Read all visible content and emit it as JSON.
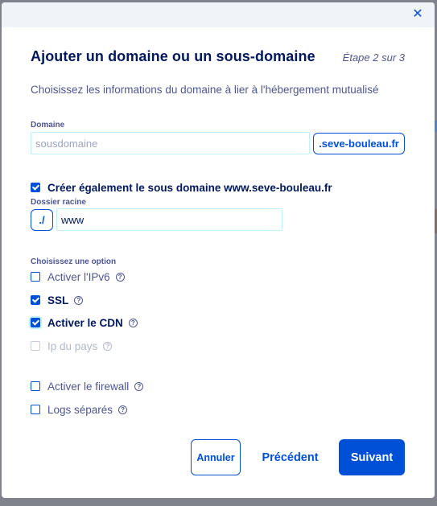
{
  "dialog": {
    "title": "Ajouter un domaine ou un sous-domaine",
    "step": "Étape 2 sur 3",
    "subtitle": "Choisissez les informations du domaine à lier à l'hébergement mutualisé",
    "close_icon": "close-icon"
  },
  "domain": {
    "label": "Domaine",
    "placeholder": "sousdomaine",
    "value": "",
    "suffix": ".seve-bouleau.fr"
  },
  "create_subdomain": {
    "label": "Créer également le sous domaine www.seve-bouleau.fr",
    "checked": true
  },
  "root_folder": {
    "label": "Dossier racine",
    "prefix": "./",
    "value": "www"
  },
  "options": {
    "heading": "Choisissez une option",
    "items": [
      {
        "label": "Activer l'IPv6",
        "checked": false,
        "disabled": false,
        "help": "question-icon"
      },
      {
        "label": "SSL",
        "checked": true,
        "disabled": false,
        "help": "question-icon"
      },
      {
        "label": "Activer le CDN",
        "checked": true,
        "disabled": false,
        "help": "question-icon"
      },
      {
        "label": "Ip du pays",
        "checked": false,
        "disabled": true,
        "help": "question-icon"
      },
      {
        "label": "Activer le firewall",
        "checked": false,
        "disabled": false,
        "help": "question-icon"
      },
      {
        "label": "Logs séparés",
        "checked": false,
        "disabled": false,
        "help": "question-icon"
      }
    ]
  },
  "footer": {
    "cancel_label": "Annuler",
    "previous_label": "Précédent",
    "next_label": "Suivant"
  },
  "colors": {
    "primary": "#0050d7",
    "title": "#00185e",
    "text": "#4d5693",
    "input_border": "#bef1ff"
  }
}
